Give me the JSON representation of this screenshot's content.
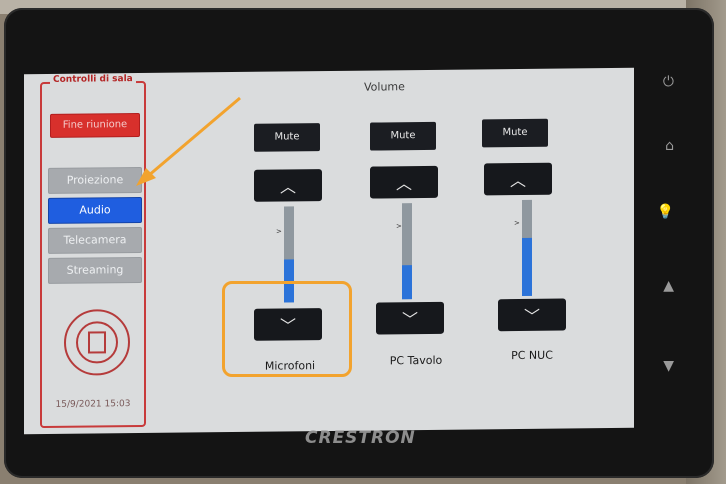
{
  "panel": {
    "title": "Controlli di sala",
    "end_meeting": "Fine riunione",
    "items": [
      {
        "label": "Proiezione",
        "active": false
      },
      {
        "label": "Audio",
        "active": true
      },
      {
        "label": "Telecamera",
        "active": false
      },
      {
        "label": "Streaming",
        "active": false
      }
    ],
    "datetime": "15/9/2021 15:03"
  },
  "volume": {
    "title": "Volume",
    "channels": [
      {
        "name": "Microfoni",
        "mute_label": "Mute",
        "level": 0.45,
        "tick": ">"
      },
      {
        "name": "PC Tavolo",
        "mute_label": "Mute",
        "level": 0.35,
        "tick": ">"
      },
      {
        "name": "PC NUC",
        "mute_label": "Mute",
        "level": 0.6,
        "tick": ">"
      }
    ]
  },
  "device": {
    "brand": "CRESTRON"
  },
  "colors": {
    "accent_blue": "#1f5ee0",
    "end_red": "#d8302c",
    "annotation_orange": "#f2a32e"
  },
  "icons": [
    "power-icon",
    "home-icon",
    "lightbulb-icon",
    "volume-up-icon",
    "volume-down-icon",
    "chevron-up-icon",
    "chevron-down-icon"
  ]
}
